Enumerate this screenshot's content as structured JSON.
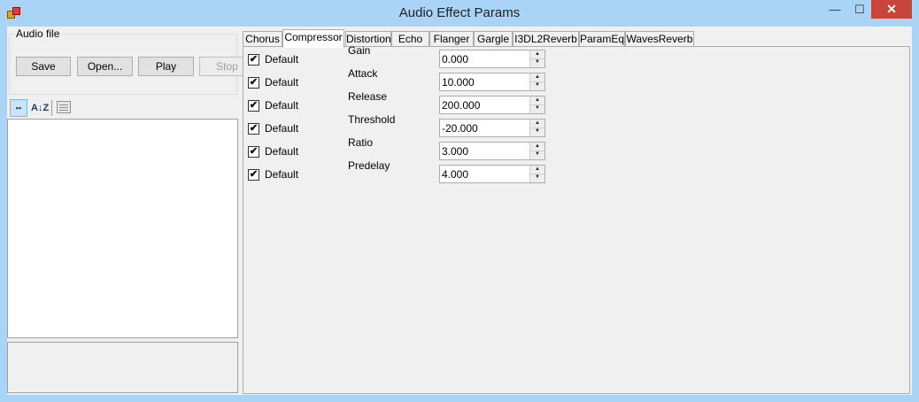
{
  "window": {
    "title": "Audio Effect Params"
  },
  "audio_file": {
    "group_label": "Audio file",
    "save_label": "Save",
    "open_label": "Open...",
    "play_label": "Play",
    "stop_label": "Stop"
  },
  "toolstrip": {
    "categorized_icon": "categorized-icon",
    "alphabetical_icon": "alphabetical-sort-icon",
    "alphabetical_text": "A↓Z",
    "property_pages_icon": "property-pages-icon"
  },
  "tabs": [
    "Chorus",
    "Compressor",
    "Distortion",
    "Echo",
    "Flanger",
    "Gargle",
    "I3DL2Reverb",
    "ParamEq",
    "WavesReverb"
  ],
  "active_tab": "Compressor",
  "params": [
    {
      "checked": true,
      "default_label": "Default",
      "name": "Gain",
      "value": "0.000"
    },
    {
      "checked": true,
      "default_label": "Default",
      "name": "Attack",
      "value": "10.000"
    },
    {
      "checked": true,
      "default_label": "Default",
      "name": "Release",
      "value": "200.000"
    },
    {
      "checked": true,
      "default_label": "Default",
      "name": "Threshold",
      "value": "-20.000"
    },
    {
      "checked": true,
      "default_label": "Default",
      "name": "Ratio",
      "value": "3.000"
    },
    {
      "checked": true,
      "default_label": "Default",
      "name": "Predelay",
      "value": "4.000"
    }
  ],
  "glyphs": {
    "check": "✔",
    "up": "▲",
    "down": "▼",
    "minimize": "—",
    "maximize": "☐",
    "close": "✕"
  }
}
